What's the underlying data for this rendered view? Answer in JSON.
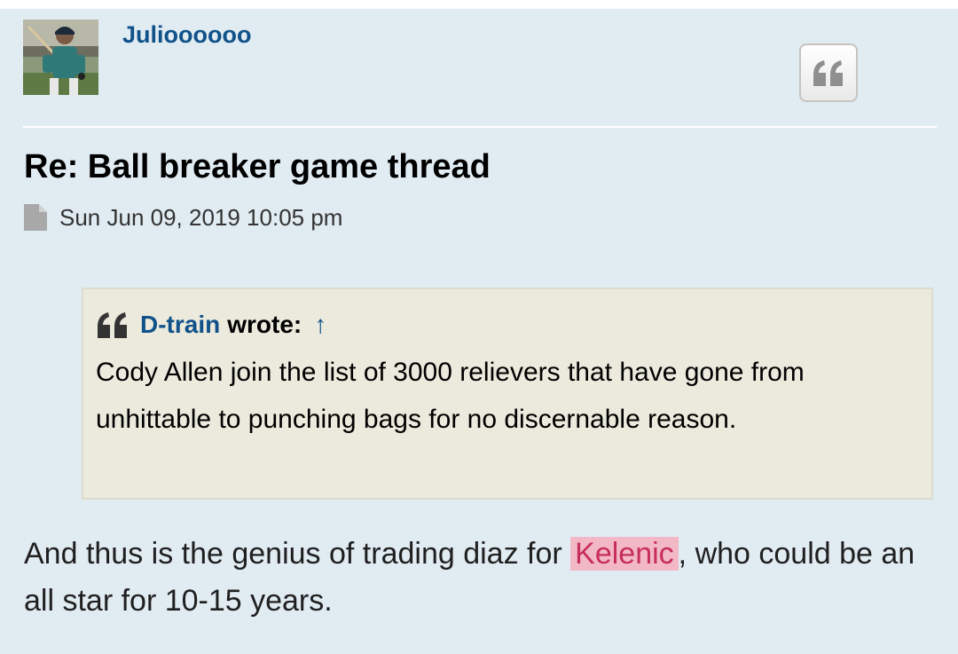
{
  "post": {
    "author": "Julioooooo",
    "title": "Re: Ball breaker game thread",
    "date": "Sun Jun 09, 2019 10:05 pm",
    "quote": {
      "author": "D-train",
      "wrote_label": "wrote:",
      "jump_arrow": "↑",
      "text": "Cody Allen join the list of 3000 relievers that have gone from unhittable to punching bags for no discernable reason."
    },
    "body": {
      "before": "And thus is the genius of trading diaz for ",
      "highlight": "Kelenic",
      "after": ", who could be an all star for 10-15 years."
    }
  },
  "icons": {
    "quote_button": "quote-icon",
    "quote_mark": "quote-icon",
    "post_marker": "file-icon"
  },
  "colors": {
    "post_background": "#e1ebf2",
    "link": "#105289",
    "quote_background": "#ebeadd",
    "highlight_background": "#f2b8c5",
    "highlight_text": "#c72e5b"
  }
}
